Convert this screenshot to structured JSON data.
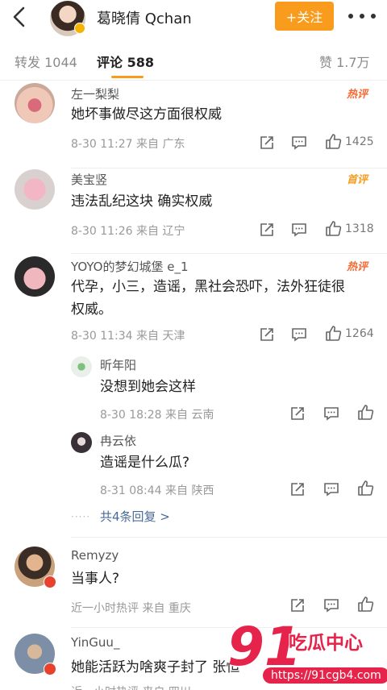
{
  "header": {
    "back_icon": "chevron-left-icon",
    "user_name": "葛晓倩 Qchan",
    "follow_label": "+关注",
    "more_icon": "more-dots-icon",
    "accent": "#f99b1c"
  },
  "tabs": {
    "repost": "转发 1044",
    "comments": "评论 588",
    "likes": "赞 1.7万"
  },
  "comments": [
    {
      "user": "左一梨梨",
      "tag": "热评",
      "text": "她坏事做尽这方面很权威",
      "meta": "8-30 11:27  来自 广东",
      "likes": "1425"
    },
    {
      "user": "美宝竖",
      "tag": "首评",
      "text": "违法乱纪这块 确实权威",
      "meta": "8-30 11:26  来自 辽宁",
      "likes": "1318"
    },
    {
      "user": "YOYO的梦幻城堡 e_1",
      "tag": "热评",
      "text_line1": "代孕，小三，造谣，黑社会恐吓，法外狂徒很",
      "text_line2": "权威。",
      "meta": "8-30 11:34  来自 天津",
      "likes": "1264",
      "replies": [
        {
          "user": "昕年阳",
          "text": "没想到她会这样",
          "meta": "8-30 18:28  来自 云南"
        },
        {
          "user": "冉云依",
          "text": "造谣是什么瓜?",
          "meta": "8-31 08:44  来自 陕西"
        }
      ],
      "more_replies": "共4条回复 >"
    },
    {
      "user": "Remyzy",
      "text": "当事人?",
      "meta": "近一小时热评  来自 重庆"
    },
    {
      "user": "YinGuu_",
      "text": "她能活跃为啥爽子封了 张恒",
      "meta": "近一小时热评  来自 四川"
    }
  ],
  "watermark": {
    "logo_number": "91",
    "title": "吃瓜中心",
    "url": "https://91cgb4.com"
  }
}
